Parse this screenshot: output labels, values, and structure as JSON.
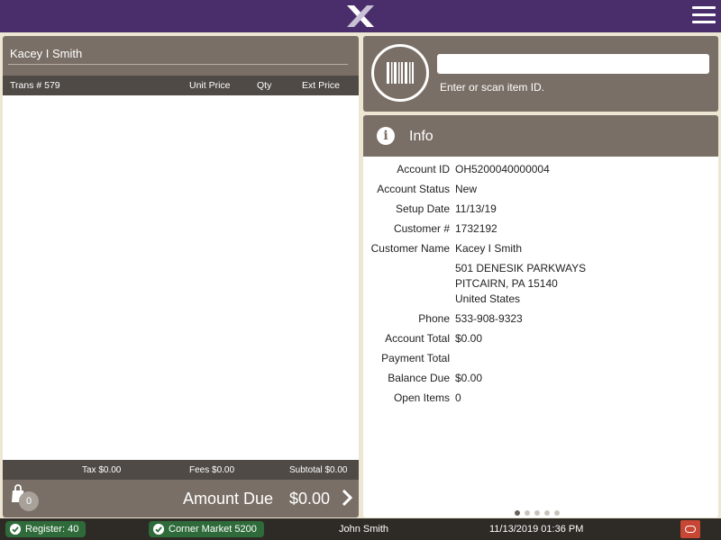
{
  "header": {
    "logo_icon": "x-logo-icon",
    "menu_icon": "hamburger-menu-icon",
    "bar_color": "#4a2e6b"
  },
  "transaction": {
    "customer_name": "Kacey I Smith",
    "trans_label": "Trans # 579",
    "columns": {
      "unit_price": "Unit Price",
      "qty": "Qty",
      "ext_price": "Ext Price"
    },
    "tax": "Tax $0.00",
    "fees": "Fees $0.00",
    "subtotal": "Subtotal $0.00",
    "bag_count": "0",
    "amount_due_label": "Amount Due",
    "amount_due_value": "$0.00"
  },
  "scan": {
    "input_value": "",
    "input_placeholder": "",
    "hint": "Enter or scan item ID.",
    "icon": "barcode-icon"
  },
  "info": {
    "title": "Info",
    "icon": "info-icon",
    "rows": [
      {
        "label": "Account ID",
        "value": "OH5200040000004"
      },
      {
        "label": "Account Status",
        "value": "New"
      },
      {
        "label": "Setup Date",
        "value": "11/13/19"
      },
      {
        "label": "Customer #",
        "value": "1732192"
      },
      {
        "label": "Customer Name",
        "value": "Kacey I Smith"
      },
      {
        "label": "",
        "value": "501 DENESIK PARKWAYS"
      },
      {
        "label": "",
        "value": "PITCAIRN, PA 15140"
      },
      {
        "label": "",
        "value": "United States"
      },
      {
        "label": "Phone",
        "value": "533-908-9323"
      },
      {
        "label": "Account Total",
        "value": "$0.00"
      },
      {
        "label": "Payment Total",
        "value": ""
      },
      {
        "label": "Balance Due",
        "value": "$0.00"
      },
      {
        "label": "Open Items",
        "value": "0"
      }
    ],
    "page_count": 5,
    "active_page": 1
  },
  "status": {
    "register": "Register: 40",
    "store": "Corner Market 5200",
    "user": "John Smith",
    "datetime": "11/13/2019 01:36 PM",
    "accent_green": "#2f6b3a",
    "oracle_color": "#c74634"
  }
}
